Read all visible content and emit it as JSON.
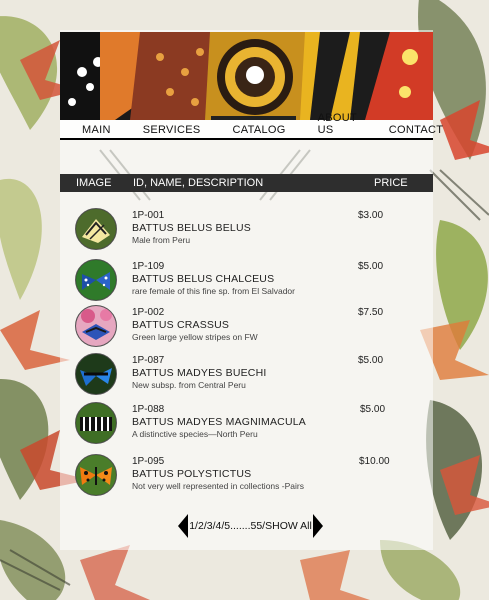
{
  "nav": {
    "items": [
      {
        "label": "MAIN"
      },
      {
        "label": "SERVICES"
      },
      {
        "label": "CATALOG",
        "active": true
      },
      {
        "label": "ABOUT US"
      },
      {
        "label": "CONTACT"
      }
    ]
  },
  "table": {
    "headers": {
      "image": "IMAGE",
      "id": "ID, NAME, DESCRIPTION",
      "price": "PRICE"
    },
    "rows": [
      {
        "code": "1P-001",
        "name": "BATTUS BELUS BELUS",
        "desc": "Male from Peru",
        "price": "$3.00",
        "thumb": "swallowtail-yellow"
      },
      {
        "code": "1P-109",
        "name": "BATTUS BELUS CHALCEUS",
        "desc": "rare female of this fine sp. from El Salvador",
        "price": "$5.00",
        "thumb": "blue-spotted"
      },
      {
        "code": "1P-002",
        "name": "BATTUS CRASSUS",
        "desc": "Green large yellow stripes on FW",
        "price": "$7.50",
        "thumb": "pink-blue"
      },
      {
        "code": "1P-087",
        "name": "BATTUS MADYES BUECHI",
        "desc": "New subsp. from Central Peru",
        "price": "$5.00",
        "thumb": "blue-black"
      },
      {
        "code": "1P-088",
        "name": "BATTUS MADYES MAGNIMACULA",
        "desc": "A distinctive species—North Peru",
        "price": "$5.00",
        "thumb": "striped"
      },
      {
        "code": "1P-095",
        "name": "BATTUS POLYSTICTUS",
        "desc": "Not very well represented in collections -Pairs",
        "price": "$10.00",
        "thumb": "orange-black"
      }
    ]
  },
  "pager": {
    "text": "1/2/3/4/5.......55/SHOW All"
  }
}
